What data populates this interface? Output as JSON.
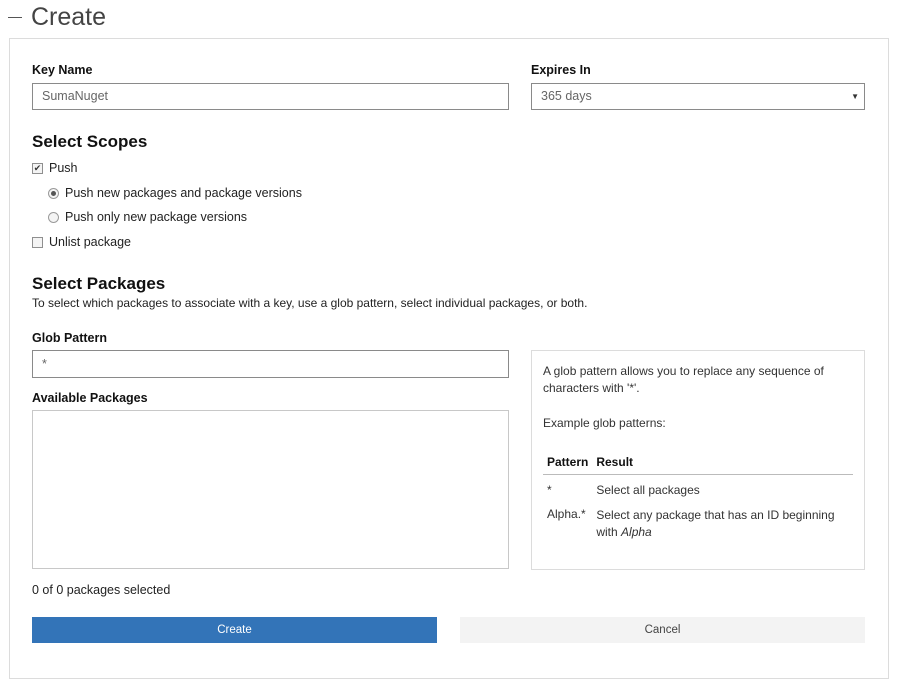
{
  "page": {
    "title": "Create"
  },
  "form": {
    "key_name_label": "Key Name",
    "key_name_value": "SumaNuget",
    "expires_label": "Expires In",
    "expires_value": "365 days",
    "scopes_heading": "Select Scopes",
    "push_label": "Push",
    "push_checked": true,
    "push_option_1": "Push new packages and package versions",
    "push_option_2": "Push only new package versions",
    "unlist_label": "Unlist package",
    "packages_heading": "Select Packages",
    "packages_description": "To select which packages to associate with a key, use a glob pattern, select individual packages, or both.",
    "glob_label": "Glob Pattern",
    "glob_value": "*",
    "available_label": "Available Packages",
    "selected_count": "0 of 0 packages selected"
  },
  "glob_help": {
    "line1": "A glob pattern allows you to replace any sequence of",
    "line2": "characters with '*'.",
    "examples_label": "Example glob patterns:",
    "col_pattern": "Pattern",
    "col_result": "Result",
    "rows": [
      {
        "pattern": "*",
        "result": "Select all packages"
      },
      {
        "pattern": "Alpha.*",
        "result_prefix": "Select any package that has an ID beginning",
        "result_line2_prefix": "with ",
        "result_em": "Alpha"
      }
    ]
  },
  "actions": {
    "create_label": "Create",
    "cancel_label": "Cancel"
  },
  "colors": {
    "primary": "#3374b8",
    "secondary_bg": "#f3f3f3"
  },
  "icons": {
    "collapse": "minus-icon",
    "select": "chevron-down-icon",
    "check": "check-icon"
  }
}
